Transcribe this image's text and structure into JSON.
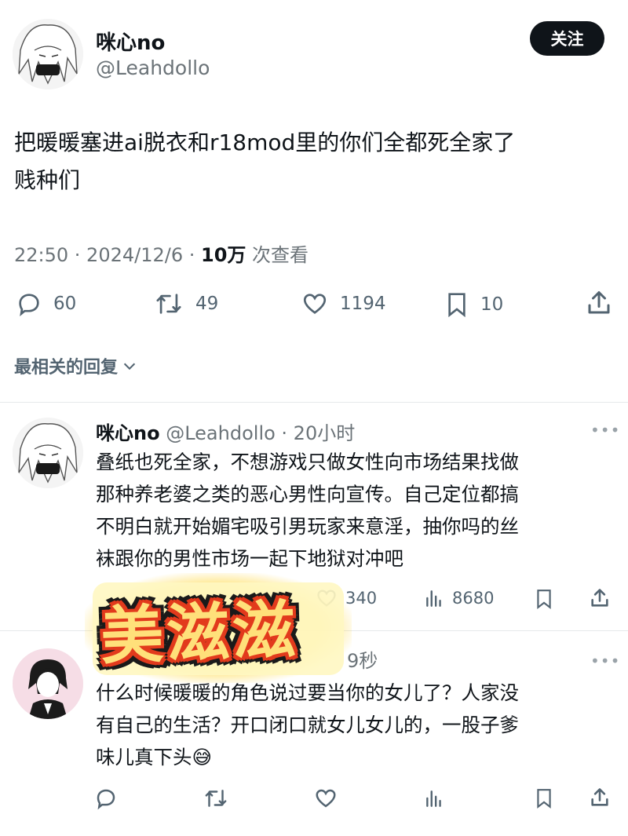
{
  "main_tweet": {
    "author_name": "咪心no",
    "handle": "@Leahdollo",
    "follow_label": "关注",
    "text_line1": "把暖暖塞进ai脱衣和r18mod里的你们全都死全家了",
    "text_line2": "贱种们",
    "time": "22:50 · 2024/12/6 · ",
    "views_count": "10万",
    "views_label": " 次查看",
    "stats": {
      "replies": "60",
      "retweets": "49",
      "likes": "1194",
      "bookmarks": "10"
    }
  },
  "replies_header": {
    "label": "最相关的回复",
    "chevron": "chevron-down-icon"
  },
  "reply1": {
    "author_name": "咪心no",
    "handle_time": "@Leahdollo · 20小时",
    "lines": [
      "叠纸也死全家，不想游戏只做女性向市场结果找做",
      "那种养老婆之类的恶心男性向宣传。自己定位都搞",
      "不明白就开始媚宅吸引男玩家来意淫，抽你吗的丝",
      "袜跟你的男性市场一起下地狱对冲吧"
    ],
    "likes": "340",
    "views": "8680"
  },
  "reply2": {
    "time": "9秒",
    "lines": [
      "什么时候暖暖的角色说过要当你的女儿了？人家没",
      "有自己的生活？开口闭口就女儿女儿的，一股子爹",
      "味儿真下头"
    ],
    "emoji": "😅"
  },
  "sticker": {
    "text": "美滋滋"
  },
  "colors": {
    "text": "#0f1419",
    "gray": "#6b7378",
    "follow_bg": "#0f1419",
    "divider": "#e6e9eb"
  }
}
